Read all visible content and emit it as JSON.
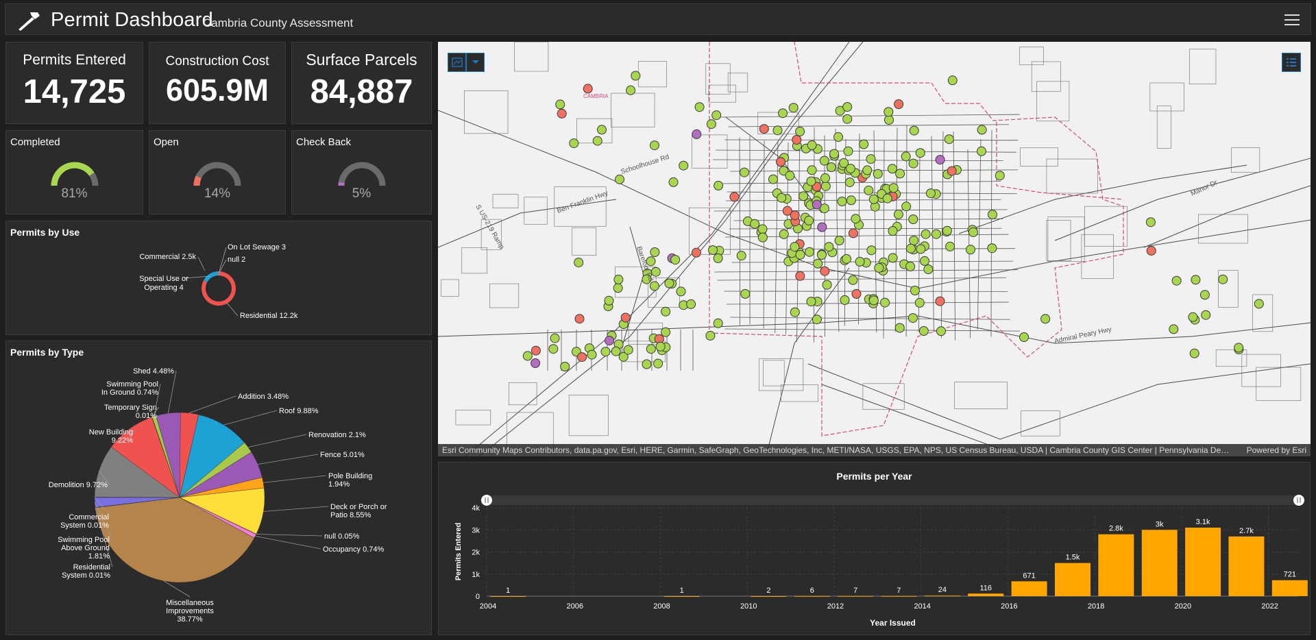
{
  "header": {
    "title": "Permit Dashboard",
    "subtitle": "Cambria County Assessment",
    "logo_icon": "hammer-icon",
    "menu_icon": "hamburger-menu-icon"
  },
  "indicators": [
    {
      "title": "Permits Entered",
      "value": "14,725"
    },
    {
      "title": "Construction Cost",
      "value": "605.9M"
    },
    {
      "title": "Surface Parcels",
      "value": "84,887"
    }
  ],
  "gauges": [
    {
      "title": "Completed",
      "value": "81%",
      "fraction": 0.81,
      "color": "#a8d74f"
    },
    {
      "title": "Open",
      "value": "14%",
      "fraction": 0.14,
      "color": "#f0715f"
    },
    {
      "title": "Check Back",
      "value": "5%",
      "fraction": 0.05,
      "color": "#b36fbf"
    }
  ],
  "permits_by_use": {
    "title": "Permits by Use",
    "chart_data": {
      "type": "pie",
      "categories": [
        "Residential",
        "Commercial",
        "Special Use or Operating",
        "On Lot Sewage",
        "null"
      ],
      "values": [
        12200,
        2500,
        4,
        3,
        2
      ],
      "labels": [
        "Residential 12.2k",
        "Commercial 2.5k",
        "Special Use or Operating 4",
        "On Lot Sewage 3",
        "null 2"
      ],
      "colors": [
        "#f0524f",
        "#1ea1d4",
        "#a8c94a",
        "#ffde3a",
        "#9b59b6"
      ]
    }
  },
  "permits_by_type": {
    "title": "Permits by Type",
    "chart_data": {
      "type": "pie",
      "categories": [
        "Addition",
        "Roof",
        "Renovation",
        "Fence",
        "Pole Building",
        "Deck or Porch or Patio",
        "null",
        "Occupancy",
        "Miscellaneous Improvements",
        "Residential System",
        "Swimming Pool Above Ground",
        "Commercial System",
        "Demolition",
        "New Building",
        "Temporary Sign",
        "Swimming Pool In Ground",
        "Shed"
      ],
      "values": [
        3.48,
        9.88,
        2.1,
        5.01,
        1.94,
        8.55,
        0.05,
        0.74,
        38.77,
        0.01,
        1.81,
        0.01,
        9.72,
        9.22,
        0.01,
        0.74,
        4.48
      ],
      "labels": [
        "Addition 3.48%",
        "Roof 9.88%",
        "Renovation 2.1%",
        "Fence 5.01%",
        "Pole Building 1.94%",
        "Deck or Porch or Patio 8.55%",
        "null 0.05%",
        "Occupancy 0.74%",
        "Miscellaneous Improvements 38.77%",
        "Residential System 0.01%",
        "Swimming Pool Above Ground 1.81%",
        "Commercial System 0.01%",
        "Demolition 9.72%",
        "New Building 9.22%",
        "Temporary Sign 0.01%",
        "Swimming Pool In Ground 0.74%",
        "Shed 4.48%"
      ],
      "colors": [
        "#f0524f",
        "#1ea1d4",
        "#a8c94a",
        "#9b59b6",
        "#ffa31a",
        "#ffde3a",
        "#e7e7e7",
        "#f27fd5",
        "#b5844a",
        "#3ab2a8",
        "#7a6fe0",
        "#4f8ed8",
        "#808080",
        "#f0524f",
        "#1ea1d4",
        "#a8c94a",
        "#9b59b6"
      ]
    }
  },
  "map": {
    "attribution": "Esri Community Maps Contributors, data.pa.gov, Esri, HERE, Garmin, SafeGraph, GeoTechnologies, Inc, METI/NASA, USGS, EPA, NPS, US Census Bureau, USDA | Cambria County GIS Center | Pennsylvania Depart...",
    "powered_by": "Powered by Esri",
    "place_label": "CAMBRIA",
    "roads": [
      "Schoolhouse Rd",
      "Ben Franklin Hwy",
      "S US-219 Ramp",
      "Barefoot Rd",
      "Admiral Peary Hwy",
      "Manor Dr"
    ],
    "status_colors": {
      "completed": "#a8d74f",
      "open": "#f0715f",
      "check_back": "#b36fbf"
    }
  },
  "permits_per_year": {
    "title": "Permits per Year",
    "chart_data": {
      "type": "bar",
      "x": [
        2004,
        2008,
        2010,
        2011,
        2012,
        2013,
        2014,
        2015,
        2016,
        2017,
        2018,
        2019,
        2020,
        2021,
        2022
      ],
      "values": [
        1,
        1,
        2,
        6,
        7,
        7,
        24,
        116,
        671,
        1500,
        2800,
        3000,
        3100,
        2700,
        721
      ],
      "data_labels": [
        "1",
        "1",
        "2",
        "6",
        "7",
        "7",
        "24",
        "116",
        "671",
        "1.5k",
        "2.8k",
        "3k",
        "3.1k",
        "2.7k",
        "721"
      ],
      "xticks": [
        "2004",
        "2006",
        "2008",
        "2010",
        "2012",
        "2014",
        "2016",
        "2018",
        "2020",
        "2022"
      ],
      "yticks": [
        "0",
        "1k",
        "2k",
        "3k",
        "4k"
      ],
      "xlabel": "Year Issued",
      "ylabel": "Permits Entered",
      "ylim": [
        0,
        4000
      ],
      "bar_color": "#ffa600"
    }
  }
}
